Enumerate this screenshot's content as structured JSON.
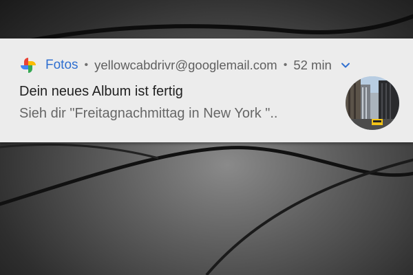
{
  "notification": {
    "app_name": "Fotos",
    "separator": "•",
    "account": "yellowcabdrivr@googlemail.com",
    "time": "52 min",
    "title": "Dein neues Album ist fertig",
    "body": "Sieh dir \"Freitagnachmittag in  New York \".."
  },
  "icons": {
    "app": "google-photos-pinwheel-icon",
    "expand": "chevron-down-icon"
  },
  "colors": {
    "app_name": "#2f6fd0",
    "notification_bg": "#ececec",
    "photos_red": "#ea4335",
    "photos_yellow": "#fbbc04",
    "photos_green": "#34a853",
    "photos_blue": "#4285f4"
  }
}
